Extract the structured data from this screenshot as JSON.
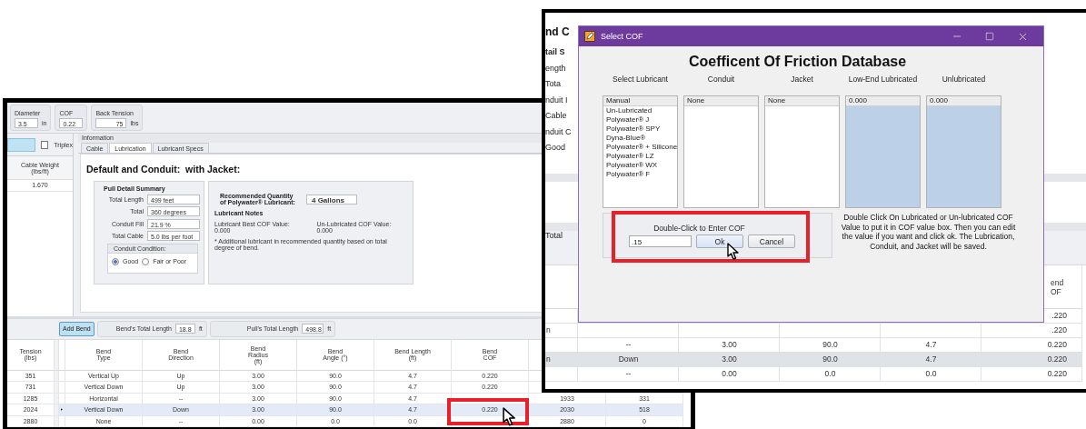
{
  "left_window": {
    "top_fields": [
      {
        "label": "Diameter",
        "value": "3.5",
        "unit": "in"
      },
      {
        "label": "COF",
        "value": "0.22"
      },
      {
        "label": "Back Tension",
        "value": "75",
        "unit": "lbs"
      }
    ],
    "side_panel": {
      "triplex": {
        "label": "Triplex",
        "checked": false
      },
      "header": "Cable Weight\n(lbs/ft)",
      "value": "1.670"
    },
    "information": {
      "title": "Information",
      "tabs": [
        {
          "label": "Cable",
          "selected": false
        },
        {
          "label": "Lubrication",
          "selected": true
        },
        {
          "label": "Lubricant Specs",
          "selected": false
        }
      ],
      "heading": "Default and Conduit:  with Jacket:",
      "summary": {
        "title": "Pull Detail Summary",
        "fields": [
          {
            "label": "Total Length",
            "value": "499  feet"
          },
          {
            "label": "Total",
            "value": "360  degrees"
          },
          {
            "label": "Conduit Fill",
            "value": "21.9 %"
          },
          {
            "label": "Total Cable",
            "value": "5.0  lbs per foot"
          }
        ],
        "condition": {
          "title": "Conduit Condition:",
          "options": [
            {
              "label": "Good",
              "selected": true
            },
            {
              "label": "Fair or Poor",
              "selected": false
            }
          ]
        }
      },
      "lubricant": {
        "quantity_label": "Recommended Quantity\nof Polywater® Lubricant:",
        "quantity": "4  Gallons",
        "notes_title": "Lubricant Notes",
        "best_cof": "Lubricant Best COF Value: 0.000",
        "unlubricated_cof": "Un-Lubricated COF Value: 0.000",
        "note": "* Additional lubricant in recommended quantity based on total degree of bend."
      }
    },
    "toolbar": {
      "add_button": "Add Bend",
      "fields": [
        {
          "label": "Bend's Total Length",
          "value": "18.8",
          "unit": "ft"
        },
        {
          "label": "Pull's Total Length",
          "value": "498.8",
          "unit": "ft"
        }
      ]
    },
    "table": {
      "columns": [
        "Tension\n(lbs)",
        "Bend\nType",
        "Bend\nDirection",
        "Bend\nRadius\n(ft)",
        "Bend\nAngle (°)",
        "Bend Length\n(ft)",
        "Bend\nCOF",
        null,
        null
      ],
      "rows": [
        {
          "selected": false,
          "cells": [
            "351",
            "Vertical Up",
            "Up",
            "3.00",
            "90.0",
            "4.7",
            "0.220",
            null,
            null
          ]
        },
        {
          "selected": false,
          "cells": [
            "731",
            "Vertical Down",
            "Up",
            "3.00",
            "90.0",
            "4.7",
            "0.220",
            null,
            null
          ]
        },
        {
          "selected": false,
          "cells": [
            "1285",
            "Horizontal",
            "--",
            "3.00",
            "90.0",
            "4.7",
            null,
            "1933",
            "331"
          ]
        },
        {
          "selected": true,
          "cells": [
            "2024",
            "Vertical Down",
            "Down",
            "3.00",
            "90.0",
            "4.7",
            "0.220",
            "2030",
            "518"
          ]
        },
        {
          "selected": false,
          "cells": [
            "2880",
            "None",
            "--",
            "0.00",
            "0.0",
            "0.0",
            null,
            "2880",
            "0"
          ]
        }
      ]
    }
  },
  "right_window": {
    "heading": "nd C",
    "labels": [
      "tail S",
      "ength",
      "Tota",
      "nduit I",
      "Cable",
      "nduit C",
      "Good"
    ],
    "toolbar_text": "Total",
    "table": {
      "columns": [
        null,
        null,
        null,
        null,
        null,
        "end\nOF"
      ],
      "rows": [
        {
          "selected": false,
          "cells": [
            null,
            null,
            null,
            null,
            null,
            ".220"
          ]
        },
        {
          "selected": false,
          "cells": [
            "n",
            null,
            null,
            null,
            null,
            ".220"
          ]
        },
        {
          "selected": false,
          "cells": [
            null,
            "--",
            "3.00",
            "90.0",
            "4.7",
            "0.220"
          ]
        },
        {
          "selected": true,
          "cells": [
            "n",
            "Down",
            "3.00",
            "90.0",
            "4.7",
            "0.220"
          ]
        },
        {
          "selected": false,
          "cells": [
            null,
            "--",
            "0.00",
            "0.0",
            "0.0",
            "0.220"
          ]
        }
      ]
    }
  },
  "dialog": {
    "title": "Select COF",
    "heading": "Coefficent Of Friction Database",
    "columns": [
      {
        "label": "Select Lubricant",
        "kind": "list",
        "items": [
          {
            "label": "Manual",
            "selected": true
          },
          {
            "label": "Un-Lubricated",
            "selected": false
          },
          {
            "label": "Polywater® J",
            "selected": false
          },
          {
            "label": "Polywater® SPY",
            "selected": false
          },
          {
            "label": "Dyna-Blue®",
            "selected": false
          },
          {
            "label": "Polywater® + Silicone",
            "selected": false
          },
          {
            "label": "Polywater® LZ",
            "selected": false
          },
          {
            "label": "Polywater® WX",
            "selected": false
          },
          {
            "label": "Polywater® F",
            "selected": false
          }
        ]
      },
      {
        "label": "Conduit",
        "kind": "list",
        "items": [
          {
            "label": "None",
            "selected": true
          }
        ]
      },
      {
        "label": "Jacket",
        "kind": "list",
        "items": [
          {
            "label": "None",
            "selected": true
          }
        ]
      },
      {
        "label": "Low-End Lubricated",
        "kind": "value",
        "items": [
          {
            "label": "0.000",
            "selected": true
          }
        ]
      },
      {
        "label": "Unlubricated",
        "kind": "value",
        "items": [
          {
            "label": "0.000",
            "selected": true
          }
        ]
      }
    ],
    "entry_label": "Double-Click to Enter COF",
    "entry_value": ".15",
    "ok": "Ok",
    "cancel": "Cancel",
    "instructions": "Double Click On Lubricated or Un-lubricated COF Value to put it in COF value box. Then you can edit the value if you want and click ok. The Lubrication, Conduit, and Jacket will be saved."
  }
}
